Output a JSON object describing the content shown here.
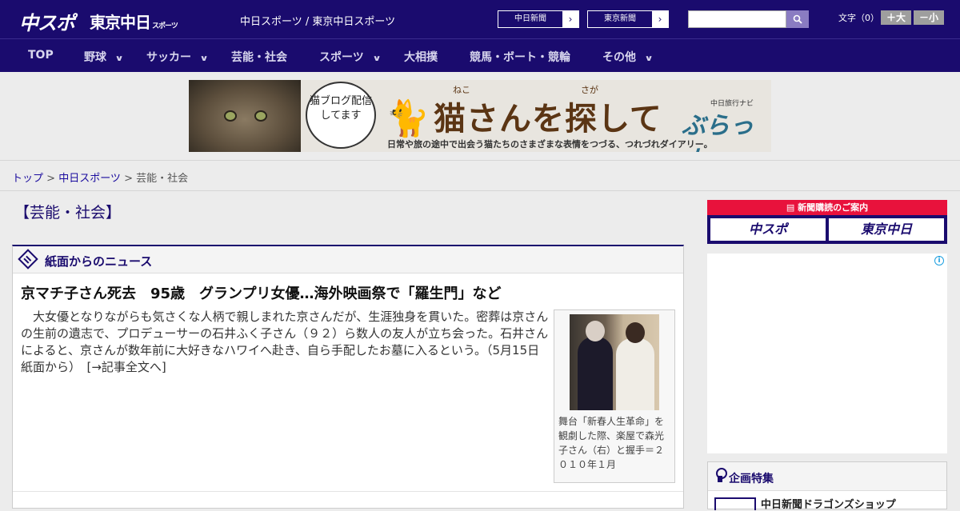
{
  "header": {
    "logo_chuspo": "中スポ",
    "logo_tokyo": "東京中日",
    "logo_tokyo_small": "スポーツ",
    "site_title": "中日スポーツ / 東京中日スポーツ",
    "btn_chunichi": "中日新聞",
    "btn_tokyo": "東京新聞",
    "search_placeholder": "",
    "fontsize_label": "文字（0）",
    "font_larger": "＋大",
    "font_smaller": "－小"
  },
  "nav": {
    "items": [
      {
        "label": "TOP"
      },
      {
        "label": "野球"
      },
      {
        "label": "サッカー"
      },
      {
        "label": "芸能・社会"
      },
      {
        "label": "スポーツ"
      },
      {
        "label": "大相撲"
      },
      {
        "label": "競馬・ボート・競輪"
      },
      {
        "label": "その他"
      }
    ]
  },
  "banner": {
    "bubble_text": "猫ブログ配信してます",
    "title": "猫さんを探して",
    "ruby_neko": "ねこ",
    "ruby_saga": "さが",
    "subtitle": "日常や旅の途中で出会う猫たちのさまざまな表情をつづる、つれづれダイアリー。",
    "brand_small": "中日旅行ナビ",
    "brand": "ぶらっ人"
  },
  "breadcrumb": {
    "top": "トップ",
    "sep1": " > ",
    "chunichi": "中日スポーツ",
    "sep2": " > ",
    "current": "芸能・社会"
  },
  "section_title": "【芸能・社会】",
  "news_box": {
    "title": "紙面からのニュース",
    "headline": "京マチ子さん死去　95歳　グランプリ女優…海外映画祭で「羅生門」など",
    "body": "大女優となりながらも気さくな人柄で親しまれた京さんだが、生涯独身を貫いた。密葬は京さんの生前の遺志で、プロデューサーの石井ふく子さん（９２）ら数人の友人が立ち会った。石井さんによると、京さんが数年前に大好きなハワイへ赴き、自ら手配したお墓に入るという。（5月15日 紙面から）　[→記事全文へ]",
    "photo_caption": "舞台「新春人生革命」を観劇した際、楽屋で森光子さん（右）と握手＝２０１０年１月"
  },
  "sidebar": {
    "subscribe_head": "新聞購読のご案内",
    "subscribe_chuspo": "中スポ",
    "subscribe_tokyo": "東京中日",
    "ad_info": "i",
    "feature_title": "企画特集",
    "feature_item": "中日新聞ドラゴンズショップ"
  }
}
